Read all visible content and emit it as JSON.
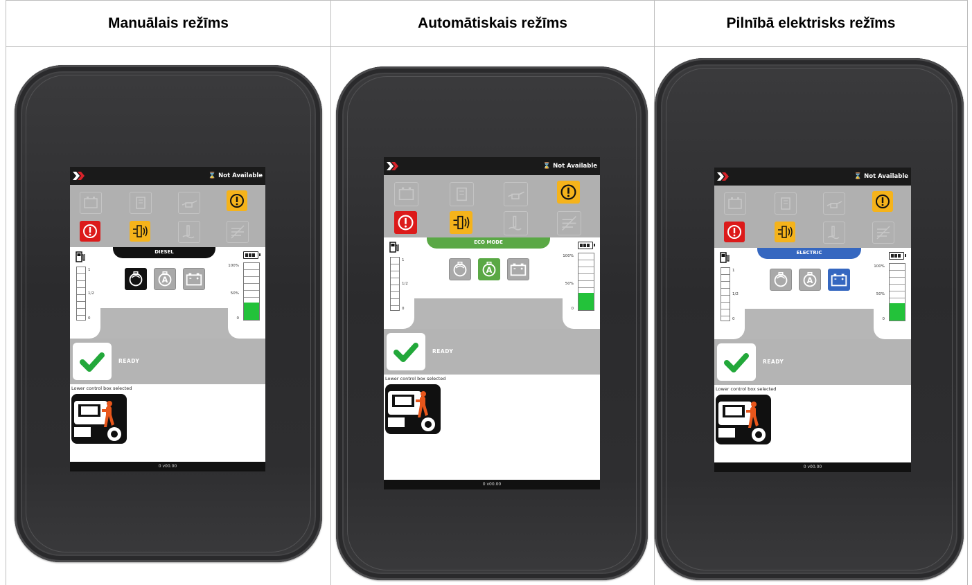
{
  "columns": [
    {
      "header": "Manuālais režīms",
      "screen": {
        "status": "Not Available",
        "mode_bar_label": "DIESEL",
        "mode_bar_color": "#111111",
        "active_mode": "diesel",
        "fuel_labels": [
          "1",
          "1/2",
          "0"
        ],
        "battery_labels": [
          "100%",
          "50%",
          "0"
        ],
        "battery_level_fraction": 0.3,
        "ready_label": "READY",
        "lower_text": "Lower control box selected",
        "footer": "0 v00.00"
      }
    },
    {
      "header": "Automātiskais režīms",
      "screen": {
        "status": "Not Available",
        "mode_bar_label": "ECO MODE",
        "mode_bar_color": "#5aa845",
        "active_mode": "auto",
        "fuel_labels": [
          "1",
          "1/2",
          "0"
        ],
        "battery_labels": [
          "100%",
          "50%",
          "0"
        ],
        "battery_level_fraction": 0.3,
        "ready_label": "READY",
        "lower_text": "Lower control box selected",
        "footer": "0 v00.00"
      }
    },
    {
      "header": "Pilnībā elektrisks režīms",
      "screen": {
        "status": "Not Available",
        "mode_bar_label": "ELECTRIC",
        "mode_bar_color": "#3567c0",
        "active_mode": "electric",
        "fuel_labels": [
          "1",
          "1/2",
          "0"
        ],
        "battery_labels": [
          "100%",
          "50%",
          "0"
        ],
        "battery_level_fraction": 0.3,
        "ready_label": "READY",
        "lower_text": "Lower control box selected",
        "footer": "0 v00.00"
      }
    }
  ],
  "colors": {
    "warning_amber": "#f5b31b",
    "warning_red": "#dc1a1a",
    "ready_green": "#22a83a",
    "battery_green": "#23c23a",
    "operator_orange": "#e8561b"
  },
  "icons": {
    "warning_row_1": [
      "battery-icon",
      "filter-icon",
      "oil-can-icon",
      "engine-warning-icon"
    ],
    "warning_row_2": [
      "stop-warning-icon",
      "glow-plug-icon",
      "coolant-icon",
      "exhaust-icon"
    ],
    "modes": [
      "diesel-engine-icon",
      "auto-mode-icon",
      "battery-mode-icon"
    ]
  }
}
